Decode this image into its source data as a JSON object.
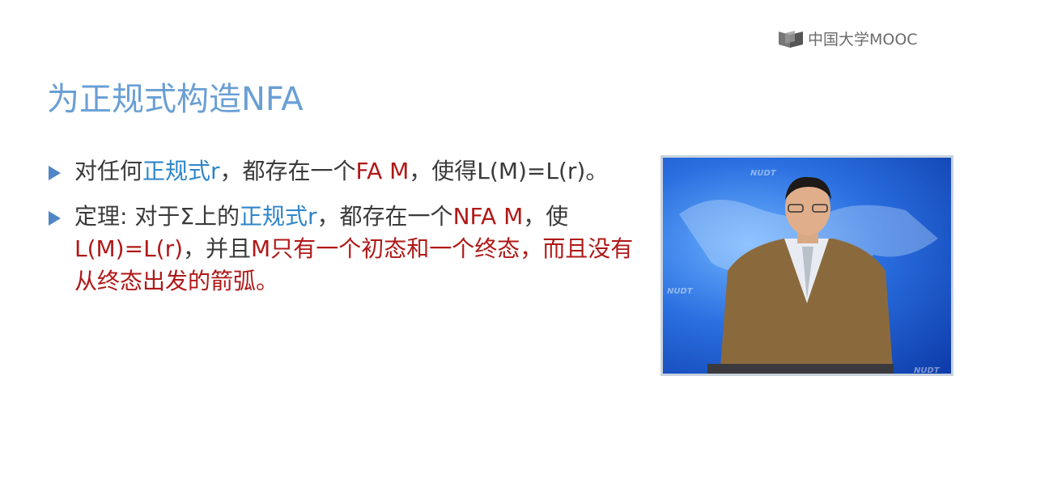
{
  "logo": {
    "text": "中国大学MOOC"
  },
  "slide": {
    "title": "为正规式构造NFA",
    "bullets": [
      {
        "segments": [
          {
            "text": "对任何",
            "style": "normal"
          },
          {
            "text": "正规式r",
            "style": "blue"
          },
          {
            "text": "，都存在一个",
            "style": "normal"
          },
          {
            "text": "FA M",
            "style": "red"
          },
          {
            "text": "，使得L(M)=L(r)。",
            "style": "normal"
          }
        ]
      },
      {
        "segments": [
          {
            "text": "定理: 对于Σ上的",
            "style": "normal"
          },
          {
            "text": "正规式r",
            "style": "blue"
          },
          {
            "text": "，都存在一个",
            "style": "normal"
          },
          {
            "text": "NFA M",
            "style": "red"
          },
          {
            "text": "，使",
            "style": "normal"
          },
          {
            "text": "L(M)=L(r)",
            "style": "red"
          },
          {
            "text": "，并且",
            "style": "normal"
          },
          {
            "text": "M只有一个初态和一个终态，而且没有从终态出发的箭弧。",
            "style": "red"
          }
        ]
      }
    ]
  },
  "video": {
    "watermark": "NUDT"
  },
  "colors": {
    "title": "#6a9fd4",
    "blue": "#2e86c9",
    "red": "#b01818",
    "bullet": "#4f86c6"
  }
}
